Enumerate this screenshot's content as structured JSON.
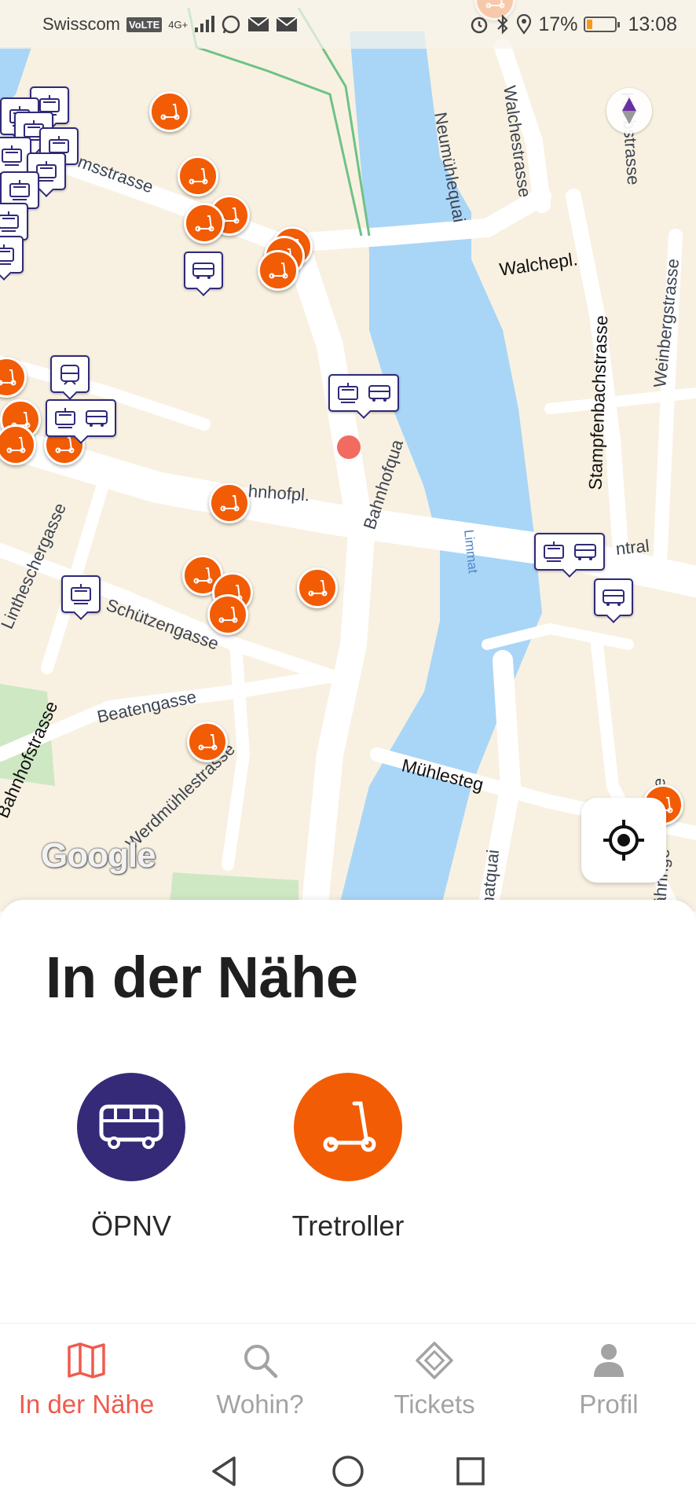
{
  "status_bar": {
    "carrier": "Swisscom",
    "volte": "VoLTE",
    "network": "4G+",
    "battery_percent": "17%",
    "time": "13:08"
  },
  "map": {
    "attribution": "Google",
    "streets": {
      "walchestrasse": "Walchestrasse",
      "neumuehlequai": "Neumühlequai",
      "walchepl": "Walchepl.",
      "stampfenbachstrasse": "Stampfenbachstrasse",
      "weinbergstrasse": "Weinbergstrasse",
      "harbstrasse": "Harbstrasse",
      "msstrasse": "msstrasse",
      "bahnhofpl": "hnhofpl.",
      "bahnhofquai": "Bahnhofqua",
      "limmat": "Limmat",
      "central": "ntral",
      "lintheschergasse": "Lintheschergasse",
      "schuetzengasse": "Schützengasse",
      "beatengasse": "Beatengasse",
      "bahnhofstrasse": "Bahnhofstrasse",
      "werdmuehlestrasse": "Werdmühlestrasse",
      "muehlesteg": "Mühlesteg",
      "limmatquai": "matquai",
      "haehringer": "ähringe",
      "se": "se"
    }
  },
  "sheet": {
    "title": "In der Nähe",
    "categories": [
      {
        "label": "ÖPNV",
        "icon": "bus-icon",
        "color": "#342a78"
      },
      {
        "label": "Tretroller",
        "icon": "scooter-icon",
        "color": "#f25c05"
      }
    ]
  },
  "nav": {
    "items": [
      {
        "label": "In der Nähe",
        "icon": "map-icon",
        "active": true
      },
      {
        "label": "Wohin?",
        "icon": "search-icon",
        "active": false
      },
      {
        "label": "Tickets",
        "icon": "ticket-icon",
        "active": false
      },
      {
        "label": "Profil",
        "icon": "person-icon",
        "active": false
      }
    ]
  },
  "colors": {
    "accent": "#ef5a4d",
    "scooter": "#f25c05",
    "transit": "#342a78",
    "map_land": "#f8f1e1",
    "map_water": "#a9d6f7"
  }
}
